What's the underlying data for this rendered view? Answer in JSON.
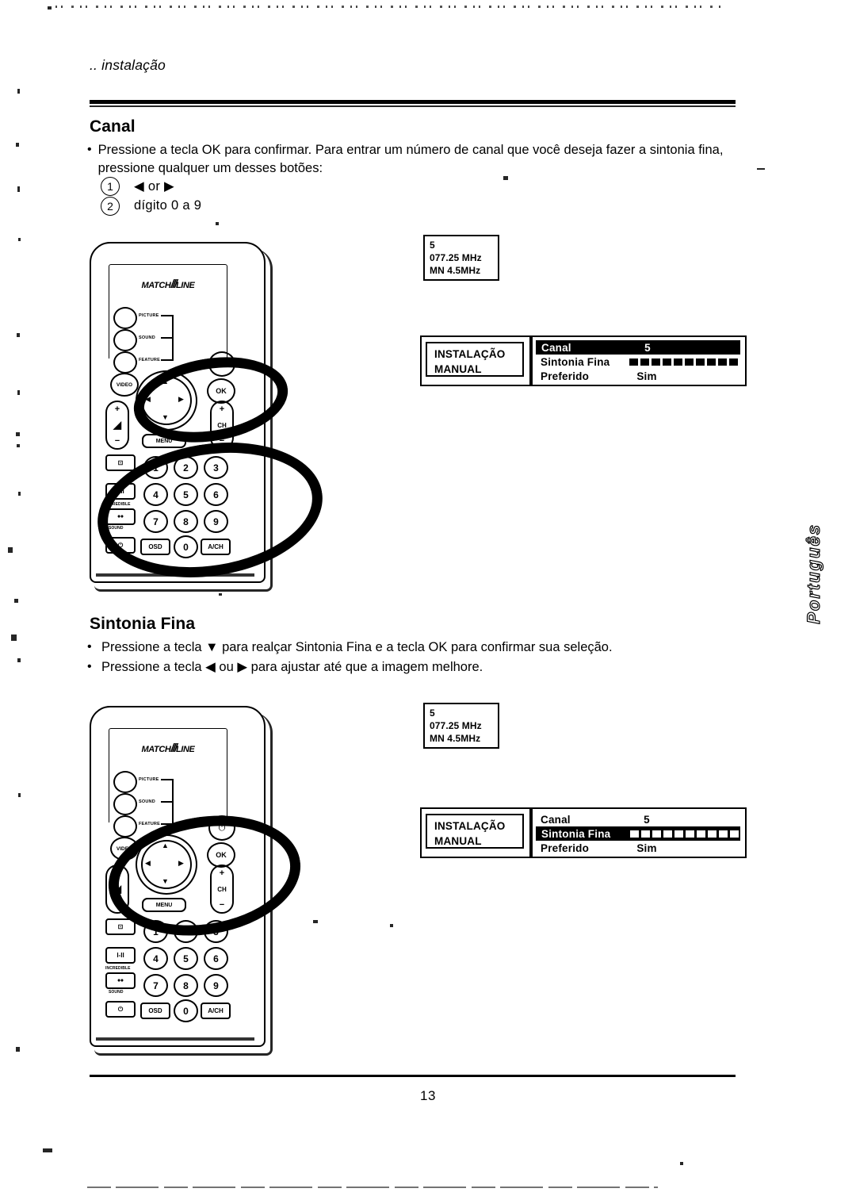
{
  "document": {
    "running_head": ".. instalação",
    "page_number": "13",
    "side_tab": "Português"
  },
  "sections": [
    {
      "id": "canal",
      "heading": "Canal",
      "bullets": [
        "Pressione a tecla OK para confirmar. Para entrar um número de canal que você deseja fazer a sintonia fina, pressione qualquer um desses botões:"
      ],
      "numbered": [
        {
          "marker": "1",
          "text": "◀ or ▶"
        },
        {
          "marker": "2",
          "text": "dígito 0 a 9"
        }
      ]
    },
    {
      "id": "sintonia-fina",
      "heading": "Sintonia Fina",
      "bullets": [
        "Pressione a tecla ▼ para realçar Sintonia Fina e a tecla OK para confirmar sua seleção.",
        "Pressione a tecla ◀ ou ▶ para ajustar até que a imagem melhore."
      ]
    }
  ],
  "remote": {
    "brand": "MATCH",
    "brand_suffix": "LINE",
    "brand_bars": "///",
    "feature_labels": [
      "PICTURE",
      "SOUND",
      "FEATURE"
    ],
    "video_label": "VIDEO",
    "power_icon": "⏻",
    "ok_label": "OK",
    "arrow_up": "▲",
    "arrow_down": "▼",
    "arrow_left": "◀",
    "arrow_right": "▶",
    "volume_plus": "+",
    "volume_minus": "−",
    "volume_icon": "◢",
    "channel_plus": "+",
    "channel_minus": "−",
    "channel_label": "CH",
    "menu_label": "MENU",
    "keys": [
      "1",
      "2",
      "3",
      "4",
      "5",
      "6",
      "7",
      "8",
      "9"
    ],
    "key_zero": "0",
    "key_osd": "OSD",
    "key_ach": "A/CH",
    "side_keys": [
      "⊡",
      "I-II",
      "ꔷꔷ",
      "⏻"
    ],
    "side_labels_top": "INCREDIBLE",
    "side_labels_bottom": "SOUND"
  },
  "osd": {
    "info_box": {
      "channel": "5",
      "frequency": "077.25 MHz",
      "system": "MN  4.5MHz"
    },
    "title_box": {
      "line1": "INSTALAÇÃO",
      "line2": "MANUAL"
    },
    "menus": [
      {
        "id": "menu-canal-highlighted",
        "rows": [
          {
            "label": "Canal",
            "value": "5",
            "type": "value",
            "highlighted": true
          },
          {
            "label": "Sintonia Fina",
            "value": "",
            "type": "bar",
            "segments": 10,
            "highlighted": false
          },
          {
            "label": "Preferido",
            "value": "Sim",
            "type": "value",
            "highlighted": false
          }
        ]
      },
      {
        "id": "menu-sintonia-highlighted",
        "rows": [
          {
            "label": "Canal",
            "value": "5",
            "type": "value",
            "highlighted": false
          },
          {
            "label": "Sintonia Fina",
            "value": "",
            "type": "bar",
            "segments": 10,
            "highlighted": true
          },
          {
            "label": "Preferido",
            "value": "Sim",
            "type": "value",
            "highlighted": false
          }
        ]
      }
    ]
  }
}
